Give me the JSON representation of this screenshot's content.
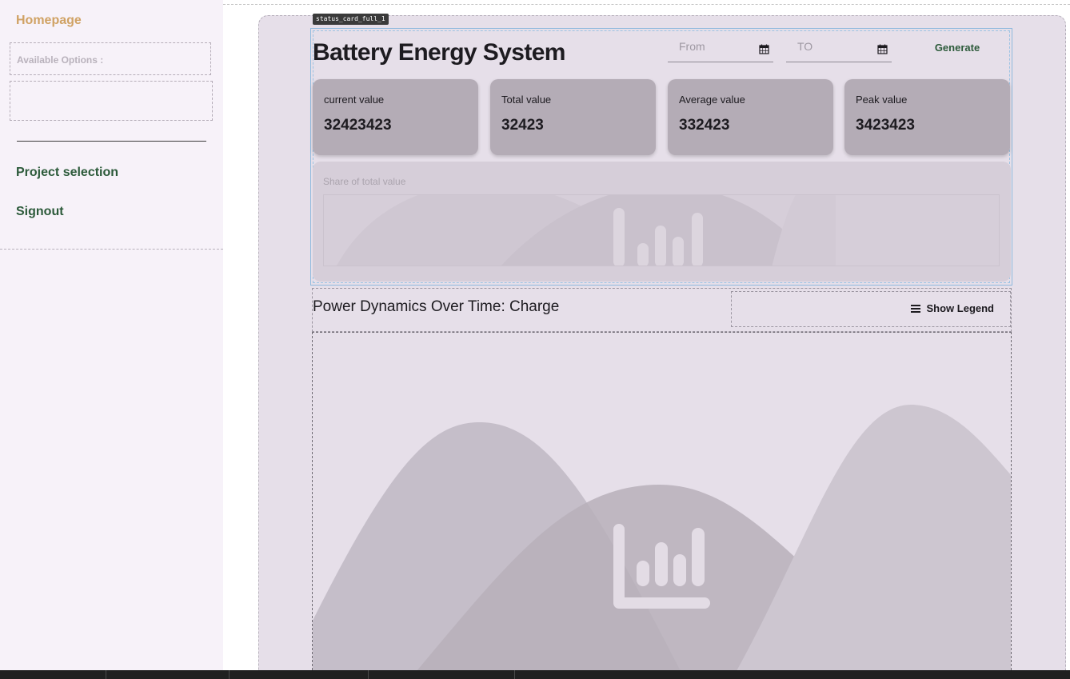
{
  "sidebar": {
    "home_label": "Homepage",
    "options_label": "Available Options :",
    "project_selection_label": "Project selection",
    "signout_label": "Signout"
  },
  "status_card": {
    "tag": "status_card_full_1"
  },
  "header": {
    "title": "Battery Energy System",
    "from_placeholder": "From",
    "to_placeholder": "TO",
    "generate_label": "Generate"
  },
  "metrics": [
    {
      "label": "current value",
      "value": "32423423"
    },
    {
      "label": "Total value",
      "value": "32423"
    },
    {
      "label": "Average value",
      "value": "332423"
    },
    {
      "label": "Peak value",
      "value": "3423423"
    }
  ],
  "share": {
    "title": "Share of total value"
  },
  "power": {
    "title": "Power Dynamics Over Time: Charge",
    "legend_label": "Show Legend"
  },
  "colors": {
    "home_link": "#d0a264",
    "nav_link": "#2c5a3a",
    "panel_background": "#e6dfe9",
    "metric_card": "#b4acb6"
  },
  "icons": {
    "calendar": "calendar-icon",
    "legend_menu": "menu-icon",
    "chart_placeholder": "chart-placeholder-icon"
  }
}
